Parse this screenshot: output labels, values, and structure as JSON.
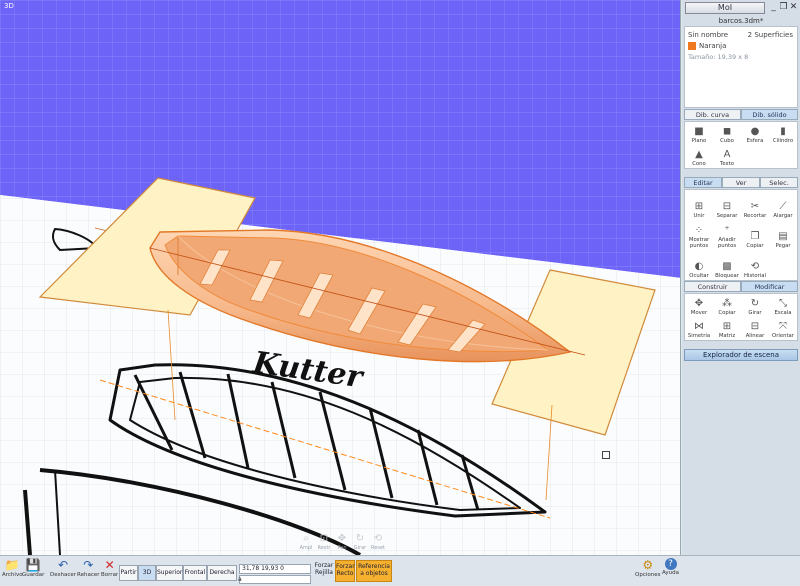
{
  "viewport": {
    "label": "3D",
    "sketch_text": "Kutter"
  },
  "window": {
    "app_button": "MoI",
    "minimize_icon": "_",
    "restore_icon": "❐",
    "close_icon": "✕",
    "file_name": "barcos.3dm*"
  },
  "properties": {
    "object_name": "Sin nombre",
    "selection_count": "2 Superficies",
    "style_name": "Naranja",
    "style_color": "#f07820",
    "size": "Tamaño: 19,39 x 8"
  },
  "draw_tabs": [
    "Dib. curva",
    "Dib. sólido"
  ],
  "draw_tools": [
    {
      "label": "Plano",
      "icon": "■"
    },
    {
      "label": "Cubo",
      "icon": "◼"
    },
    {
      "label": "Esfera",
      "icon": "●"
    },
    {
      "label": "Cilindro",
      "icon": "▮"
    },
    {
      "label": "Cono",
      "icon": "▲"
    },
    {
      "label": "Texto",
      "icon": "A"
    }
  ],
  "edit_tabs": [
    "Editar",
    "Ver",
    "Selec."
  ],
  "edit_tools": [
    {
      "label": "Unir",
      "icon": "⊞"
    },
    {
      "label": "Separar",
      "icon": "⊟"
    },
    {
      "label": "Recortar",
      "icon": "✂"
    },
    {
      "label": "Alargar",
      "icon": "⟋"
    },
    {
      "label": "Mostrar puntos",
      "icon": "⁘"
    },
    {
      "label": "Añadir puntos",
      "icon": "⁺"
    },
    {
      "label": "Copiar",
      "icon": "❐"
    },
    {
      "label": "Pegar",
      "icon": "▤"
    },
    {
      "label": "Ocultar",
      "icon": "◐"
    },
    {
      "label": "Bloquear",
      "icon": "▩"
    },
    {
      "label": "Historial",
      "icon": "⟲"
    }
  ],
  "transform_tabs": [
    "Construir",
    "Modificar"
  ],
  "transform_tools": [
    {
      "label": "Mover",
      "icon": "✥"
    },
    {
      "label": "Copiar",
      "icon": "⁂"
    },
    {
      "label": "Girar",
      "icon": "↻"
    },
    {
      "label": "Escala",
      "icon": "⤡"
    },
    {
      "label": "Simetría",
      "icon": "⋈"
    },
    {
      "label": "Matriz",
      "icon": "⊞"
    },
    {
      "label": "Alinear",
      "icon": "⊟"
    },
    {
      "label": "Orientar",
      "icon": "⤧"
    }
  ],
  "scene_browser": "Explorador de escena",
  "nav_tools": [
    {
      "label": "Ampl",
      "icon": "⌕"
    },
    {
      "label": "Restr",
      "icon": "⊡"
    },
    {
      "label": "Pan",
      "icon": "✥"
    },
    {
      "label": "Girar",
      "icon": "↻"
    },
    {
      "label": "Reset",
      "icon": "⟲"
    }
  ],
  "bottombar": {
    "file_buttons": [
      {
        "label": "Archivo",
        "icon": "📁"
      },
      {
        "label": "Guardar",
        "icon": "💾"
      },
      {
        "label": "Deshacer",
        "icon": "↶"
      },
      {
        "label": "Rehacer",
        "icon": "↷"
      },
      {
        "label": "Borrar",
        "icon": "✕"
      }
    ],
    "view_buttons": [
      "Partir",
      "3D",
      "Superior",
      "Frontal",
      "Derecha"
    ],
    "active_view": "3D",
    "coords": "31,78    19,93    0",
    "coord_a_label": "a",
    "snap_labels": [
      {
        "text": "Forzar Rejilla",
        "on": false
      },
      {
        "text": "Forzar Recto",
        "on": true
      },
      {
        "text": "Referencia a objetos",
        "on": true
      }
    ],
    "options_label": "Opciones",
    "help_label": "Ayuda",
    "options_icon": "⚙",
    "help_icon": "?"
  }
}
